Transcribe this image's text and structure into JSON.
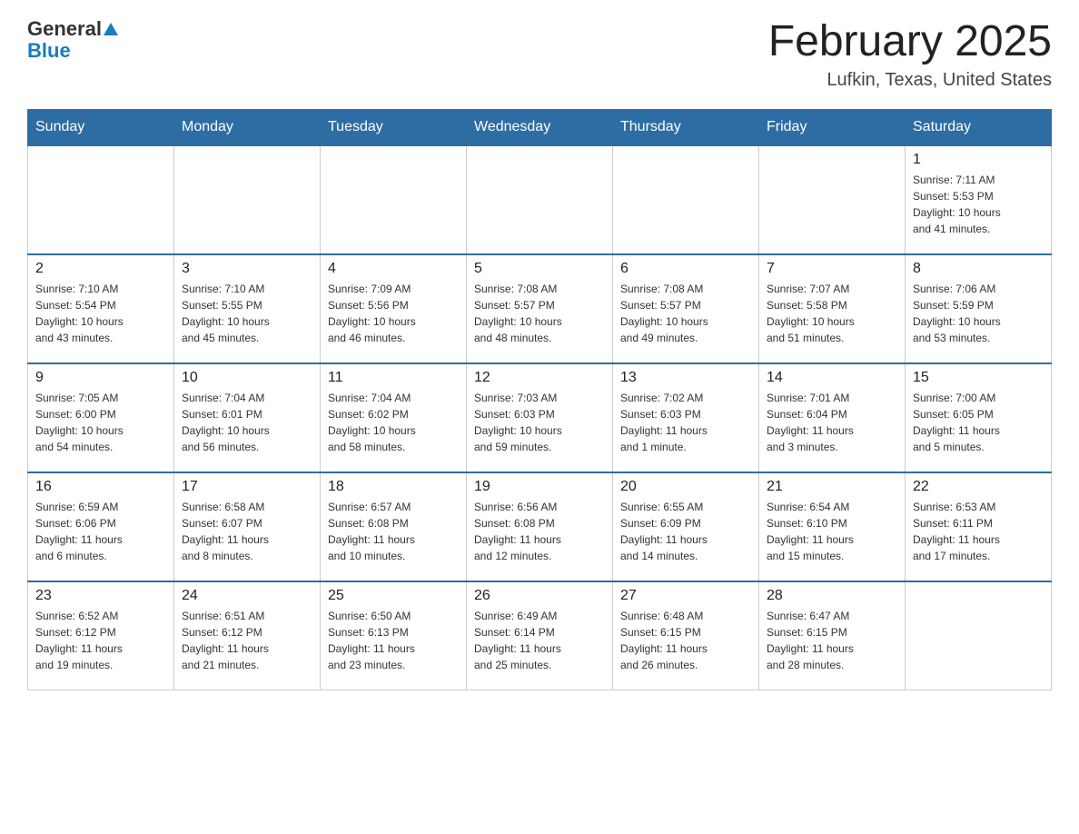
{
  "header": {
    "logo_general": "General",
    "logo_blue": "Blue",
    "month_title": "February 2025",
    "location": "Lufkin, Texas, United States"
  },
  "days_of_week": [
    "Sunday",
    "Monday",
    "Tuesday",
    "Wednesday",
    "Thursday",
    "Friday",
    "Saturday"
  ],
  "weeks": [
    {
      "days": [
        {
          "date": "",
          "info": ""
        },
        {
          "date": "",
          "info": ""
        },
        {
          "date": "",
          "info": ""
        },
        {
          "date": "",
          "info": ""
        },
        {
          "date": "",
          "info": ""
        },
        {
          "date": "",
          "info": ""
        },
        {
          "date": "1",
          "info": "Sunrise: 7:11 AM\nSunset: 5:53 PM\nDaylight: 10 hours\nand 41 minutes."
        }
      ]
    },
    {
      "days": [
        {
          "date": "2",
          "info": "Sunrise: 7:10 AM\nSunset: 5:54 PM\nDaylight: 10 hours\nand 43 minutes."
        },
        {
          "date": "3",
          "info": "Sunrise: 7:10 AM\nSunset: 5:55 PM\nDaylight: 10 hours\nand 45 minutes."
        },
        {
          "date": "4",
          "info": "Sunrise: 7:09 AM\nSunset: 5:56 PM\nDaylight: 10 hours\nand 46 minutes."
        },
        {
          "date": "5",
          "info": "Sunrise: 7:08 AM\nSunset: 5:57 PM\nDaylight: 10 hours\nand 48 minutes."
        },
        {
          "date": "6",
          "info": "Sunrise: 7:08 AM\nSunset: 5:57 PM\nDaylight: 10 hours\nand 49 minutes."
        },
        {
          "date": "7",
          "info": "Sunrise: 7:07 AM\nSunset: 5:58 PM\nDaylight: 10 hours\nand 51 minutes."
        },
        {
          "date": "8",
          "info": "Sunrise: 7:06 AM\nSunset: 5:59 PM\nDaylight: 10 hours\nand 53 minutes."
        }
      ]
    },
    {
      "days": [
        {
          "date": "9",
          "info": "Sunrise: 7:05 AM\nSunset: 6:00 PM\nDaylight: 10 hours\nand 54 minutes."
        },
        {
          "date": "10",
          "info": "Sunrise: 7:04 AM\nSunset: 6:01 PM\nDaylight: 10 hours\nand 56 minutes."
        },
        {
          "date": "11",
          "info": "Sunrise: 7:04 AM\nSunset: 6:02 PM\nDaylight: 10 hours\nand 58 minutes."
        },
        {
          "date": "12",
          "info": "Sunrise: 7:03 AM\nSunset: 6:03 PM\nDaylight: 10 hours\nand 59 minutes."
        },
        {
          "date": "13",
          "info": "Sunrise: 7:02 AM\nSunset: 6:03 PM\nDaylight: 11 hours\nand 1 minute."
        },
        {
          "date": "14",
          "info": "Sunrise: 7:01 AM\nSunset: 6:04 PM\nDaylight: 11 hours\nand 3 minutes."
        },
        {
          "date": "15",
          "info": "Sunrise: 7:00 AM\nSunset: 6:05 PM\nDaylight: 11 hours\nand 5 minutes."
        }
      ]
    },
    {
      "days": [
        {
          "date": "16",
          "info": "Sunrise: 6:59 AM\nSunset: 6:06 PM\nDaylight: 11 hours\nand 6 minutes."
        },
        {
          "date": "17",
          "info": "Sunrise: 6:58 AM\nSunset: 6:07 PM\nDaylight: 11 hours\nand 8 minutes."
        },
        {
          "date": "18",
          "info": "Sunrise: 6:57 AM\nSunset: 6:08 PM\nDaylight: 11 hours\nand 10 minutes."
        },
        {
          "date": "19",
          "info": "Sunrise: 6:56 AM\nSunset: 6:08 PM\nDaylight: 11 hours\nand 12 minutes."
        },
        {
          "date": "20",
          "info": "Sunrise: 6:55 AM\nSunset: 6:09 PM\nDaylight: 11 hours\nand 14 minutes."
        },
        {
          "date": "21",
          "info": "Sunrise: 6:54 AM\nSunset: 6:10 PM\nDaylight: 11 hours\nand 15 minutes."
        },
        {
          "date": "22",
          "info": "Sunrise: 6:53 AM\nSunset: 6:11 PM\nDaylight: 11 hours\nand 17 minutes."
        }
      ]
    },
    {
      "days": [
        {
          "date": "23",
          "info": "Sunrise: 6:52 AM\nSunset: 6:12 PM\nDaylight: 11 hours\nand 19 minutes."
        },
        {
          "date": "24",
          "info": "Sunrise: 6:51 AM\nSunset: 6:12 PM\nDaylight: 11 hours\nand 21 minutes."
        },
        {
          "date": "25",
          "info": "Sunrise: 6:50 AM\nSunset: 6:13 PM\nDaylight: 11 hours\nand 23 minutes."
        },
        {
          "date": "26",
          "info": "Sunrise: 6:49 AM\nSunset: 6:14 PM\nDaylight: 11 hours\nand 25 minutes."
        },
        {
          "date": "27",
          "info": "Sunrise: 6:48 AM\nSunset: 6:15 PM\nDaylight: 11 hours\nand 26 minutes."
        },
        {
          "date": "28",
          "info": "Sunrise: 6:47 AM\nSunset: 6:15 PM\nDaylight: 11 hours\nand 28 minutes."
        },
        {
          "date": "",
          "info": ""
        }
      ]
    }
  ]
}
